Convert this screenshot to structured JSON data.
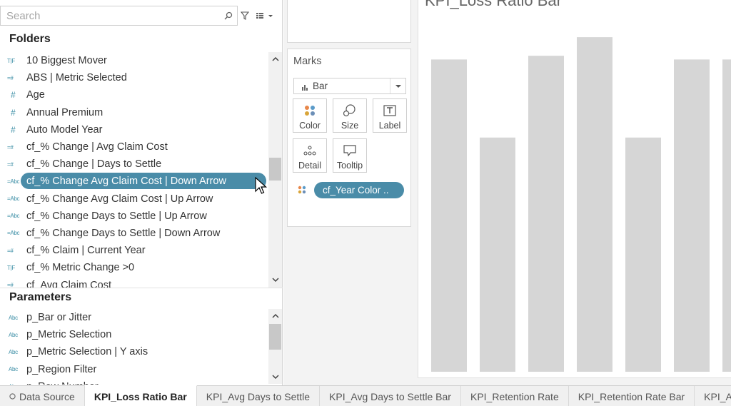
{
  "data_pane": {
    "search_placeholder": "Search",
    "folders_title": "Folders",
    "parameters_title": "Parameters",
    "fields": [
      {
        "icon": "T|F",
        "label": "10 Biggest Mover"
      },
      {
        "icon": "=#",
        "label": "ABS | Metric Selected"
      },
      {
        "icon": "#",
        "label": "Age"
      },
      {
        "icon": "#",
        "label": "Annual Premium"
      },
      {
        "icon": "#",
        "label": "Auto Model Year"
      },
      {
        "icon": "=#",
        "label": "cf_% Change | Avg Claim Cost"
      },
      {
        "icon": "=#",
        "label": "cf_% Change | Days to Settle"
      },
      {
        "icon": "=Abc",
        "label": "cf_% Change Avg Claim Cost | Down Arrow",
        "selected": true
      },
      {
        "icon": "=Abc",
        "label": "cf_% Change Avg Claim Cost | Up Arrow"
      },
      {
        "icon": "=Abc",
        "label": "cf_% Change Days to Settle  | Up Arrow"
      },
      {
        "icon": "=Abc",
        "label": "cf_% Change Days to Settle | Down Arrow"
      },
      {
        "icon": "=#",
        "label": "cf_% Claim | Current Year"
      },
      {
        "icon": "T|F",
        "label": "cf_% Metric Change >0"
      },
      {
        "icon": "=#",
        "label": "cf_Avg Claim Cost"
      }
    ],
    "parameters": [
      {
        "icon": "Abc",
        "label": "p_Bar or Jitter"
      },
      {
        "icon": "Abc",
        "label": "p_Metric Selection"
      },
      {
        "icon": "Abc",
        "label": "p_Metric Selection | Y axis"
      },
      {
        "icon": "Abc",
        "label": "p_Region Filter"
      },
      {
        "icon": "Abc",
        "label": "p_Row Number"
      }
    ]
  },
  "marks": {
    "title": "Marks",
    "mark_type": "Bar",
    "buttons": [
      {
        "label": "Color",
        "icon": "color-dots-icon"
      },
      {
        "label": "Size",
        "icon": "size-shapes-icon"
      },
      {
        "label": "Label",
        "icon": "text-label-icon"
      },
      {
        "label": "Detail",
        "icon": "detail-dots-icon"
      },
      {
        "label": "Tooltip",
        "icon": "tooltip-bubble-icon"
      }
    ],
    "color_pill": "cf_Year Color .."
  },
  "view": {
    "sheet_title": "KPI_Loss Ratio Bar",
    "bar_color": "#d6d6d6"
  },
  "chart_data": {
    "type": "bar",
    "title": "KPI_Loss Ratio Bar",
    "xlabel": "",
    "ylabel": "",
    "values": [
      0.84,
      0.63,
      0.85,
      0.9,
      0.63,
      0.84,
      0.84
    ],
    "ylim": [
      0,
      1
    ]
  },
  "tabs": [
    {
      "label": "Data Source",
      "active": false
    },
    {
      "label": "KPI_Loss Ratio Bar",
      "active": true
    },
    {
      "label": "KPI_Avg Days to Settle",
      "active": false
    },
    {
      "label": "KPI_Avg Days to Settle Bar",
      "active": false
    },
    {
      "label": "KPI_Retention Rate",
      "active": false
    },
    {
      "label": "KPI_Retention Rate Bar",
      "active": false
    },
    {
      "label": "KPI_Av",
      "active": false
    }
  ],
  "colors": {
    "accent": "#4a8ca8",
    "field_icon": "#3d8fa6"
  }
}
